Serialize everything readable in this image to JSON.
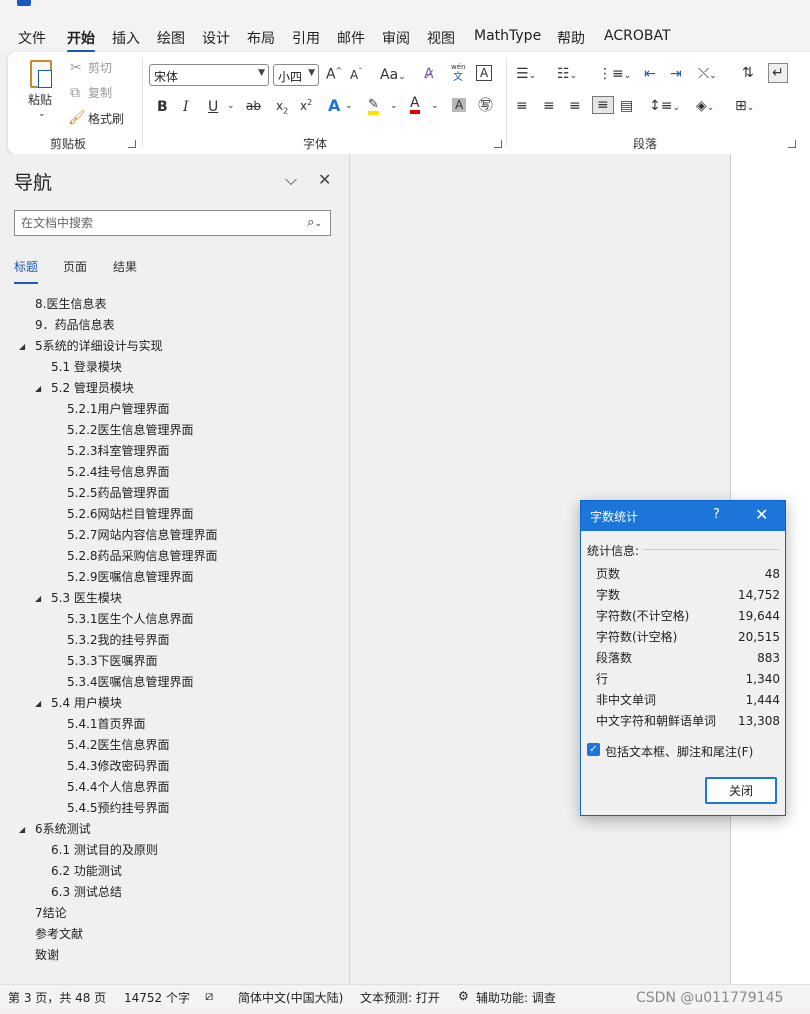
{
  "menubar": {
    "items": [
      "文件",
      "开始",
      "插入",
      "绘图",
      "设计",
      "布局",
      "引用",
      "邮件",
      "审阅",
      "视图",
      "MathType",
      "帮助",
      "ACROBAT"
    ],
    "active_index": 1
  },
  "ribbon": {
    "clipboard": {
      "paste": "粘贴",
      "cut": "剪切",
      "copy": "复制",
      "format_painter": "格式刷",
      "group_label": "剪贴板"
    },
    "font": {
      "font_name": "宋体",
      "font_size": "小四",
      "group_label": "字体",
      "phonetic": "wén"
    },
    "paragraph": {
      "group_label": "段落"
    }
  },
  "nav": {
    "title": "导航",
    "search_placeholder": "在文档中搜索",
    "tabs": [
      "标题",
      "页面",
      "结果"
    ],
    "active_tab": 0,
    "tree": [
      {
        "label": "8.医生信息表",
        "level": 1,
        "expandable": false
      },
      {
        "label": "9．药品信息表",
        "level": 1,
        "expandable": false
      },
      {
        "label": "5系统的详细设计与实现",
        "level": 1,
        "expandable": true
      },
      {
        "label": "5.1 登录模块",
        "level": 2,
        "expandable": false
      },
      {
        "label": "5.2 管理员模块",
        "level": 2,
        "expandable": true
      },
      {
        "label": "5.2.1用户管理界面",
        "level": 3,
        "expandable": false
      },
      {
        "label": "5.2.2医生信息管理界面",
        "level": 3,
        "expandable": false
      },
      {
        "label": "5.2.3科室管理界面",
        "level": 3,
        "expandable": false
      },
      {
        "label": "5.2.4挂号信息界面",
        "level": 3,
        "expandable": false
      },
      {
        "label": "5.2.5药品管理界面",
        "level": 3,
        "expandable": false
      },
      {
        "label": "5.2.6网站栏目管理界面",
        "level": 3,
        "expandable": false
      },
      {
        "label": "5.2.7网站内容信息管理界面",
        "level": 3,
        "expandable": false
      },
      {
        "label": "5.2.8药品采购信息管理界面",
        "level": 3,
        "expandable": false
      },
      {
        "label": "5.2.9医嘱信息管理界面",
        "level": 3,
        "expandable": false
      },
      {
        "label": "5.3 医生模块",
        "level": 2,
        "expandable": true
      },
      {
        "label": "5.3.1医生个人信息界面",
        "level": 3,
        "expandable": false
      },
      {
        "label": "5.3.2我的挂号界面",
        "level": 3,
        "expandable": false
      },
      {
        "label": "5.3.3下医嘱界面",
        "level": 3,
        "expandable": false
      },
      {
        "label": "5.3.4医嘱信息管理界面",
        "level": 3,
        "expandable": false
      },
      {
        "label": "5.4 用户模块",
        "level": 2,
        "expandable": true
      },
      {
        "label": "5.4.1首页界面",
        "level": 3,
        "expandable": false
      },
      {
        "label": "5.4.2医生信息界面",
        "level": 3,
        "expandable": false
      },
      {
        "label": "5.4.3修改密码界面",
        "level": 3,
        "expandable": false
      },
      {
        "label": "5.4.4个人信息界面",
        "level": 3,
        "expandable": false
      },
      {
        "label": "5.4.5预约挂号界面",
        "level": 3,
        "expandable": false
      },
      {
        "label": "6系统测试",
        "level": 1,
        "expandable": true
      },
      {
        "label": "6.1 测试目的及原则",
        "level": 2,
        "expandable": false
      },
      {
        "label": "6.2 功能测试",
        "level": 2,
        "expandable": false
      },
      {
        "label": "6.3 测试总结",
        "level": 2,
        "expandable": false
      },
      {
        "label": "7结论",
        "level": 1,
        "expandable": false
      },
      {
        "label": "参考文献",
        "level": 1,
        "expandable": false
      },
      {
        "label": "致谢",
        "level": 1,
        "expandable": false
      }
    ]
  },
  "dialog": {
    "title": "字数统计",
    "help": "?",
    "section": "统计信息:",
    "stats": [
      {
        "label": "页数",
        "value": "48"
      },
      {
        "label": "字数",
        "value": "14,752"
      },
      {
        "label": "字符数(不计空格)",
        "value": "19,644"
      },
      {
        "label": "字符数(计空格)",
        "value": "20,515"
      },
      {
        "label": "段落数",
        "value": "883"
      },
      {
        "label": "行",
        "value": "1,340"
      },
      {
        "label": "非中文单词",
        "value": "1,444"
      },
      {
        "label": "中文字符和朝鲜语单词",
        "value": "13,308"
      }
    ],
    "checkbox_label": "包括文本框、脚注和尾注(F)",
    "checkbox_checked": true,
    "close_label": "关闭"
  },
  "status": {
    "page": "第 3 页，共 48 页",
    "words": "14752 个字",
    "language": "简体中文(中国大陆)",
    "prediction": "文本预测: 打开",
    "accessibility": "辅助功能: 调查",
    "watermark": "CSDN @u011779145"
  },
  "colors": {
    "accent": "#185abd",
    "dialog_title": "#1c75d8"
  }
}
